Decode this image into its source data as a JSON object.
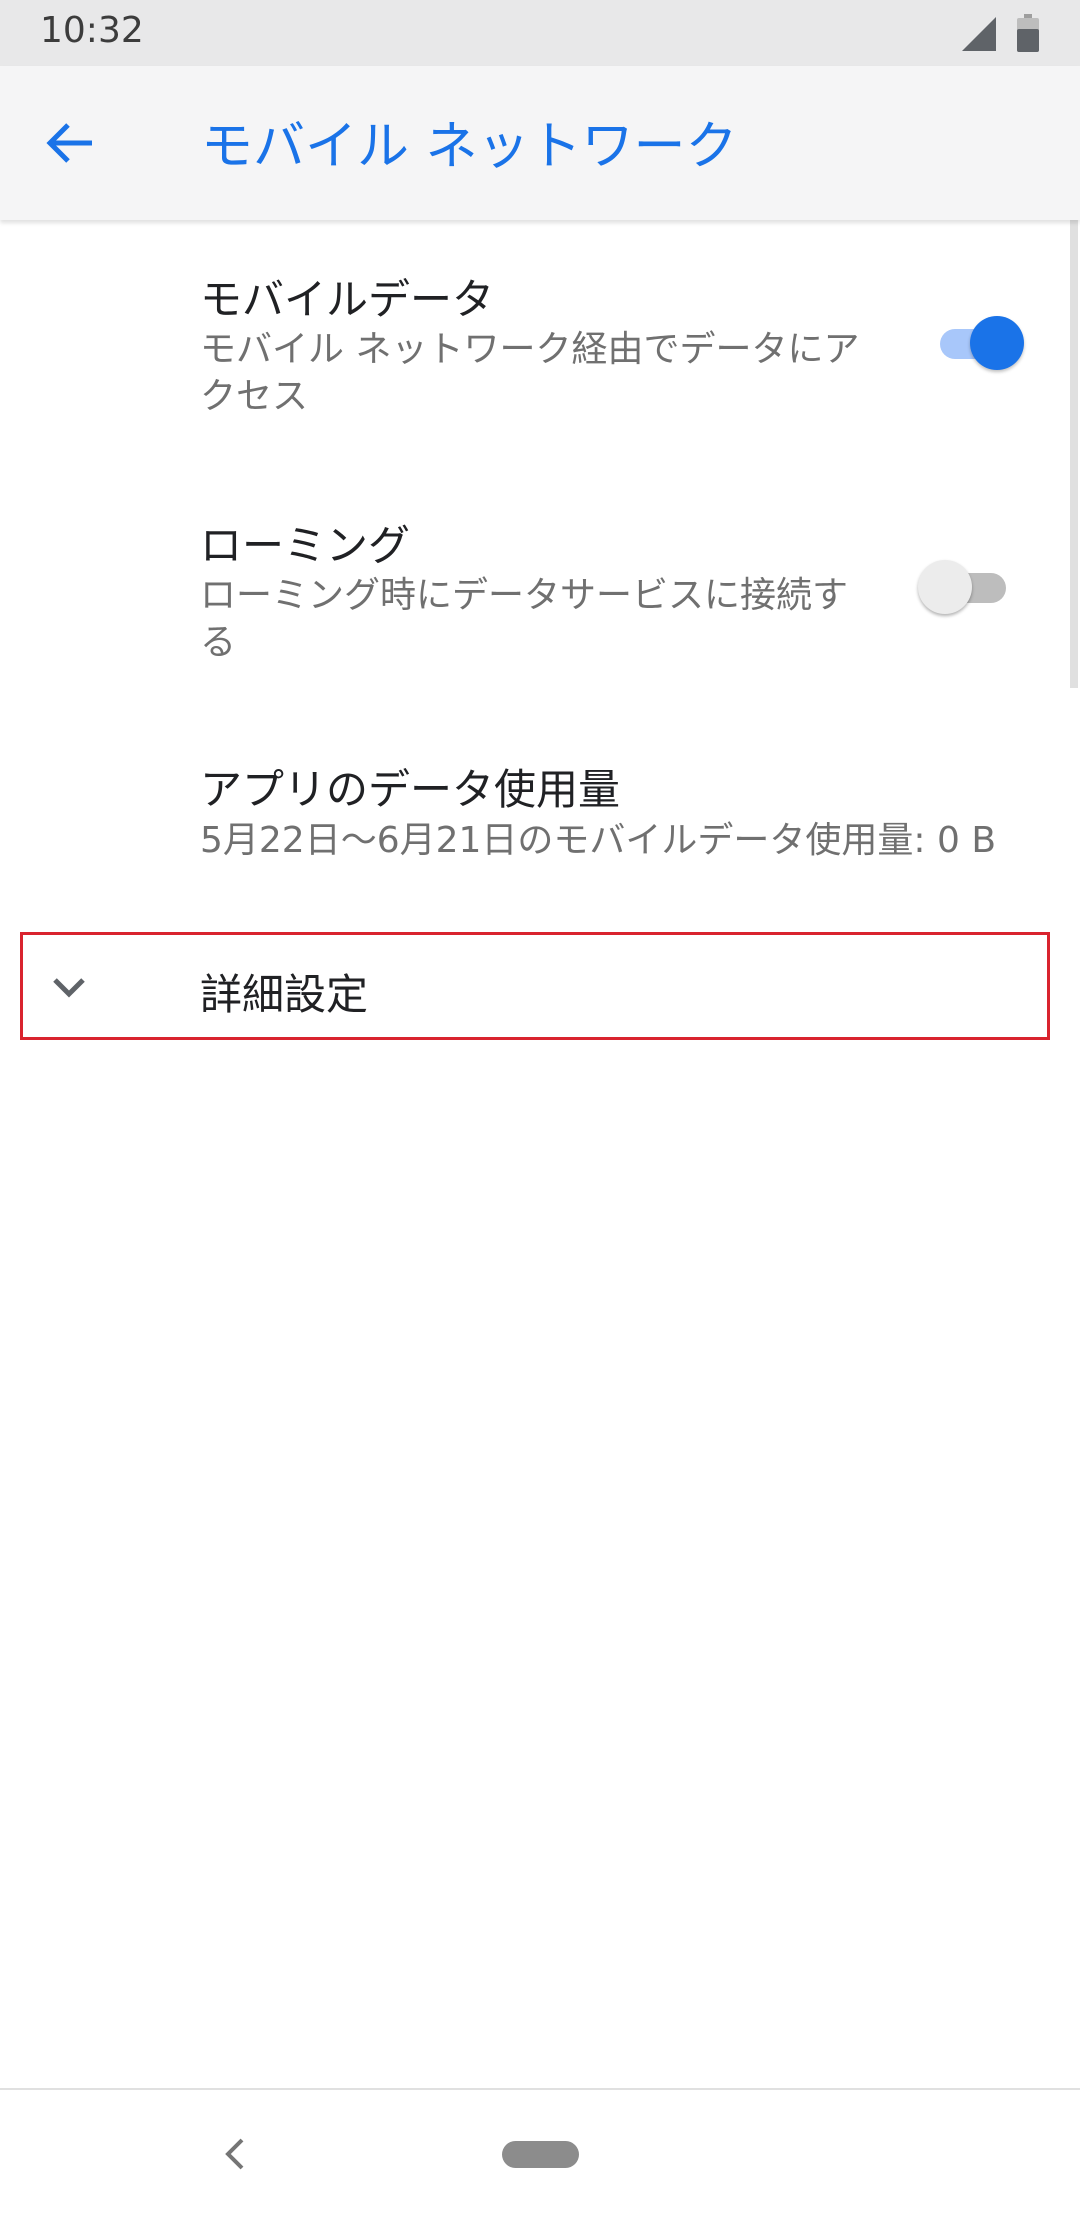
{
  "status_bar": {
    "time": "10:32"
  },
  "header": {
    "title": "モバイル ネットワーク",
    "back_icon": "arrow-back-icon"
  },
  "preferences": {
    "mobile_data": {
      "title": "モバイルデータ",
      "summary": "モバイル ネットワーク経由でデータにアクセス",
      "enabled": true
    },
    "roaming": {
      "title": "ローミング",
      "summary": "ローミング時にデータサービスに接続する",
      "enabled": false
    },
    "app_data_usage": {
      "title": "アプリのデータ使用量",
      "summary": "5月22日〜6月21日のモバイルデータ使用量: 0 B"
    },
    "advanced": {
      "label": "詳細設定",
      "icon": "chevron-down-icon"
    }
  },
  "colors": {
    "accent": "#1a73e8",
    "highlight_border": "#d9232e"
  }
}
